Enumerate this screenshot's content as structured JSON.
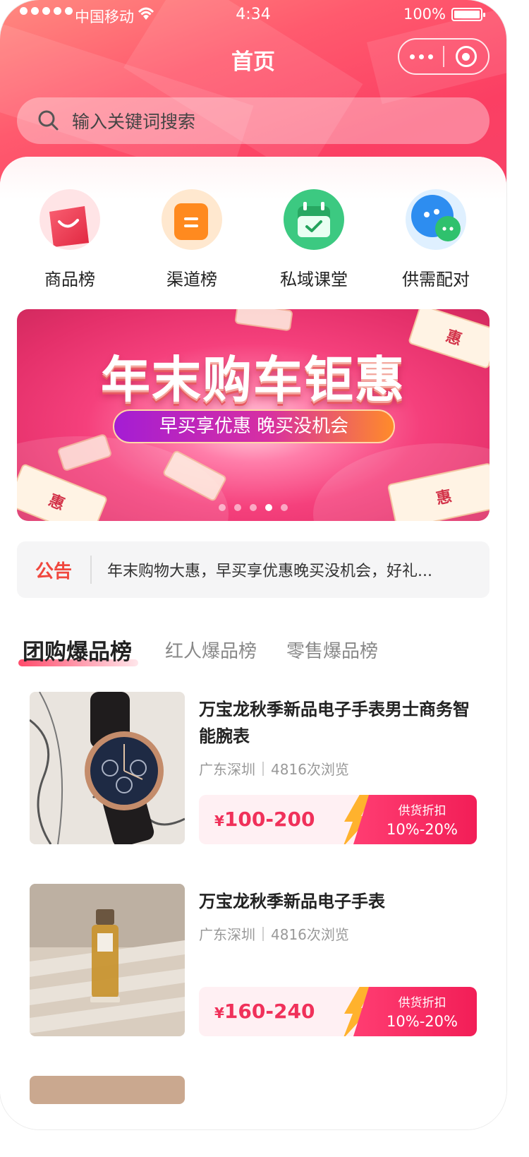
{
  "status_bar": {
    "carrier": "中国移动",
    "time": "4:34",
    "battery": "100%"
  },
  "nav": {
    "title": "首页"
  },
  "search": {
    "placeholder": "输入关键词搜索"
  },
  "quick_nav": [
    {
      "label": "商品榜",
      "icon": "shopping-bag-icon"
    },
    {
      "label": "渠道榜",
      "icon": "channel-icon"
    },
    {
      "label": "私域课堂",
      "icon": "calendar-check-icon"
    },
    {
      "label": "供需配对",
      "icon": "chat-bubbles-icon"
    }
  ],
  "banner": {
    "title": "年末购车钜惠",
    "subtitle": "早买享优惠 晚买没机会",
    "slide_count": 5,
    "active_slide": 4
  },
  "notice": {
    "tag": "公告",
    "text": "年末购物大惠，早买享优惠晚买没机会，好礼..."
  },
  "tabs": [
    {
      "label": "团购爆品榜",
      "active": true
    },
    {
      "label": "红人爆品榜",
      "active": false
    },
    {
      "label": "零售爆品榜",
      "active": false
    }
  ],
  "products": [
    {
      "name": "万宝龙秋季新品电子手表男士商务智能腕表",
      "location": "广东深圳",
      "views": "4816次浏览",
      "currency": "¥",
      "price": "100-200",
      "discount_label": "供货折扣",
      "discount_value": "10%-20%",
      "image": "watch-photo"
    },
    {
      "name": "万宝龙秋季新品电子手表",
      "location": "广东深圳",
      "views": "4816次浏览",
      "currency": "¥",
      "price": "160-240",
      "discount_label": "供货折扣",
      "discount_value": "10%-20%",
      "image": "perfume-photo"
    }
  ],
  "colors": {
    "brand": "#fb3f63",
    "price": "#f0315a",
    "notice": "#f0473e"
  }
}
